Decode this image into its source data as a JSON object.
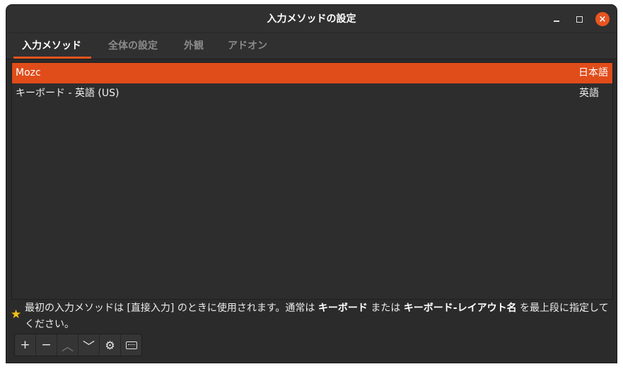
{
  "window": {
    "title": "入力メソッドの設定",
    "minimize_icon": "minimize-icon",
    "maximize_icon": "maximize-icon",
    "close_icon": "close-icon"
  },
  "tabs": [
    {
      "label": "入力メソッド",
      "active": true
    },
    {
      "label": "全体の設定",
      "active": false
    },
    {
      "label": "外観",
      "active": false
    },
    {
      "label": "アドオン",
      "active": false
    }
  ],
  "input_methods": [
    {
      "name": "Mozc",
      "language": "日本語",
      "selected": true
    },
    {
      "name": "キーボード - 英語 (US)",
      "language": "英語",
      "selected": false
    }
  ],
  "hint": {
    "icon": "star-icon",
    "part1": "最初の入力メソッドは [直接入力] のときに使用されます。通常は ",
    "bold1": "キーボード",
    "part2": " または ",
    "bold2": "キーボード-レイアウト名",
    "part3": " を最上段に指定してください。"
  },
  "toolbar": {
    "add": "+",
    "remove": "−",
    "up": "︿",
    "down": "﹀",
    "configure_icon": "gear-icon",
    "keyboard_icon": "keyboard-icon"
  },
  "colors": {
    "accent": "#e95420",
    "selection": "#e04c1a",
    "background": "#2b2b2b"
  }
}
